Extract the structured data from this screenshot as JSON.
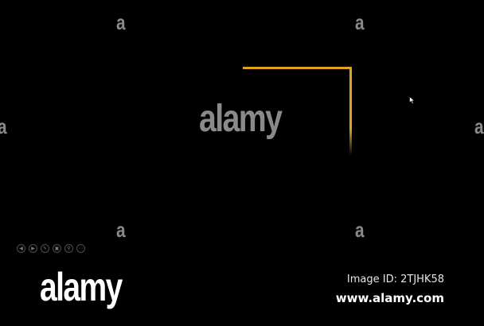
{
  "watermark": {
    "mark": "a",
    "center_text": "alamy"
  },
  "controls": {
    "items": [
      {
        "icon": "previous-icon",
        "glyph": "◀"
      },
      {
        "icon": "next-icon",
        "glyph": "▶"
      },
      {
        "icon": "pen-icon",
        "glyph": "✎"
      },
      {
        "icon": "slides-icon",
        "glyph": "▣"
      },
      {
        "icon": "zoom-icon",
        "glyph": "⚲"
      },
      {
        "icon": "more-icon",
        "glyph": "⋯"
      }
    ]
  },
  "footer": {
    "logo": "alamy",
    "image_id": "Image ID: 2TJHK58",
    "url": "www.alamy.com"
  },
  "colors": {
    "accent": "#e0a21a",
    "background": "#000000",
    "watermark": "#8a8a8a"
  }
}
